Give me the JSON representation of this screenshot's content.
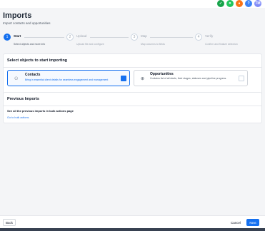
{
  "topbar": {
    "icons": [
      {
        "name": "check-icon",
        "glyph": "✓",
        "color": "#16a34a"
      },
      {
        "name": "people-icon",
        "glyph": "⚭",
        "color": "#22c55e"
      },
      {
        "name": "bell-icon",
        "glyph": "●",
        "color": "#f97316"
      },
      {
        "name": "help-icon",
        "glyph": "?",
        "color": "#3b82f6"
      },
      {
        "name": "avatar",
        "glyph": "TM",
        "color": "#818cf8"
      }
    ]
  },
  "header": {
    "title": "Imports",
    "subtitle": "Import contacts and opportunities"
  },
  "steps": [
    {
      "number": "1",
      "title": "Start",
      "desc": "Select objects and more info"
    },
    {
      "number": "2",
      "title": "Upload",
      "desc": "Upload file and configure"
    },
    {
      "number": "3",
      "title": "Map",
      "desc": "Map columns to fields"
    },
    {
      "number": "4",
      "title": "Verify",
      "desc": "Confirm and finalize selection"
    }
  ],
  "select_section": {
    "title": "Select objects to start importing",
    "options": [
      {
        "title": "Contacts",
        "desc": "Bring in essential client details for seamless engagement and management",
        "icon": "user-icon"
      },
      {
        "title": "Opportunities",
        "desc": "Contains list of all deals, their stages, statuses and pipeline progress.",
        "icon": "funnel-icon"
      }
    ]
  },
  "previous_section": {
    "title": "Previous Imports",
    "text": "See all the previous imports in bulk actions page",
    "link": "Go to bulk actions"
  },
  "footer": {
    "back": "Back",
    "cancel": "Cancel",
    "next": "Next"
  },
  "colors": {
    "accent": "#1570ef",
    "background": "#f4f5f7"
  }
}
